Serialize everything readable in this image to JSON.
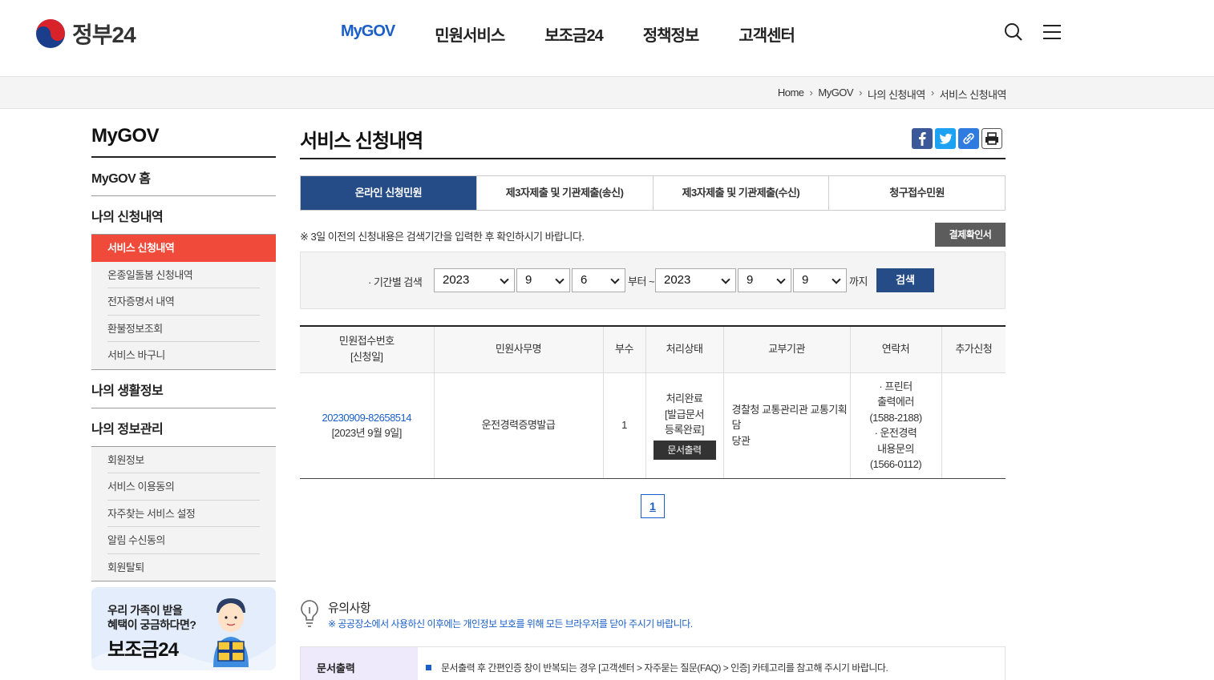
{
  "header": {
    "logo_text": "정부24",
    "nav": [
      "MyGOV",
      "민원서비스",
      "보조금24",
      "정책정보",
      "고객센터"
    ],
    "active_nav": "MyGOV"
  },
  "breadcrumb": [
    "Home",
    "MyGOV",
    "나의 신청내역",
    "서비스 신청내역"
  ],
  "sidebar": {
    "title": "MyGOV",
    "home": "MyGOV 홈",
    "section1": {
      "label": "나의 신청내역",
      "items": [
        "서비스 신청내역",
        "온종일돌봄 신청내역",
        "전자증명서 내역",
        "환불정보조회",
        "서비스 바구니"
      ]
    },
    "section2": {
      "label": "나의 생활정보"
    },
    "section3": {
      "label": "나의 정보관리",
      "items": [
        "회원정보",
        "서비스 이용동의",
        "자주찾는 서비스 설정",
        "알림 수신동의",
        "회원탈퇴"
      ]
    },
    "banner": {
      "line1": "우리 가족이 받을",
      "line2": "혜택이 궁금하다면?",
      "big": "보조금24"
    }
  },
  "main": {
    "title": "서비스 신청내역",
    "tabs": [
      "온라인 신청민원",
      "제3자제출 및 기관제출(송신)",
      "제3자제출 및 기관제출(수신)",
      "청구접수민원"
    ],
    "notice": "※ 3일 이전의 신청내용은 검색기간을 입력한 후 확인하시기 바랍니다.",
    "receipt_button": "결제확인서",
    "search": {
      "label": "· 기간별 검색",
      "from_year": "2023",
      "from_month": "9",
      "from_day": "6",
      "from_suffix": "부터 ~",
      "to_year": "2023",
      "to_month": "9",
      "to_day": "9",
      "to_suffix": "까지",
      "button": "검색"
    },
    "table": {
      "headers": {
        "num": "민원접수번호",
        "num2": "[신청일]",
        "name": "민원사무명",
        "count": "부수",
        "status": "처리상태",
        "org": "교부기관",
        "contact": "연락처",
        "extra": "추가신청"
      },
      "rows": [
        {
          "number": "20230909-82658514",
          "date": "[2023년 9월 9일]",
          "name": "운전경력증명발급",
          "count": "1",
          "status1": "처리완료",
          "status2": "[발급문서",
          "status3": "등록완료]",
          "print_button": "문서출력",
          "org1": "경찰청 교통관리관 교통기획담",
          "org2": "당관",
          "contact1": "· 프린터",
          "contact2": "출력에러",
          "contact3": "(1588-2188)",
          "contact4": "· 운전경력",
          "contact5": "내용문의",
          "contact6": "(1566-0112)",
          "extra": ""
        }
      ]
    },
    "pagination": {
      "current": "1"
    },
    "caution": {
      "title": "유의사항",
      "desc": "※ 공공장소에서 사용하신 이후에는 개인정보 보호를 위해 모든 브라우저를 닫아 주시기 바랍니다."
    },
    "guide": {
      "head": "문서출력",
      "text": "문서출력 후 간편인증 창이 반복되는 경우 [고객센터 > 자주묻는 질문(FAQ) > 인증] 카테고리를 참고해 주시기 바랍니다."
    }
  },
  "colors": {
    "primary": "#254c86",
    "accent": "#f04a3a",
    "link": "#1a5fc8"
  }
}
